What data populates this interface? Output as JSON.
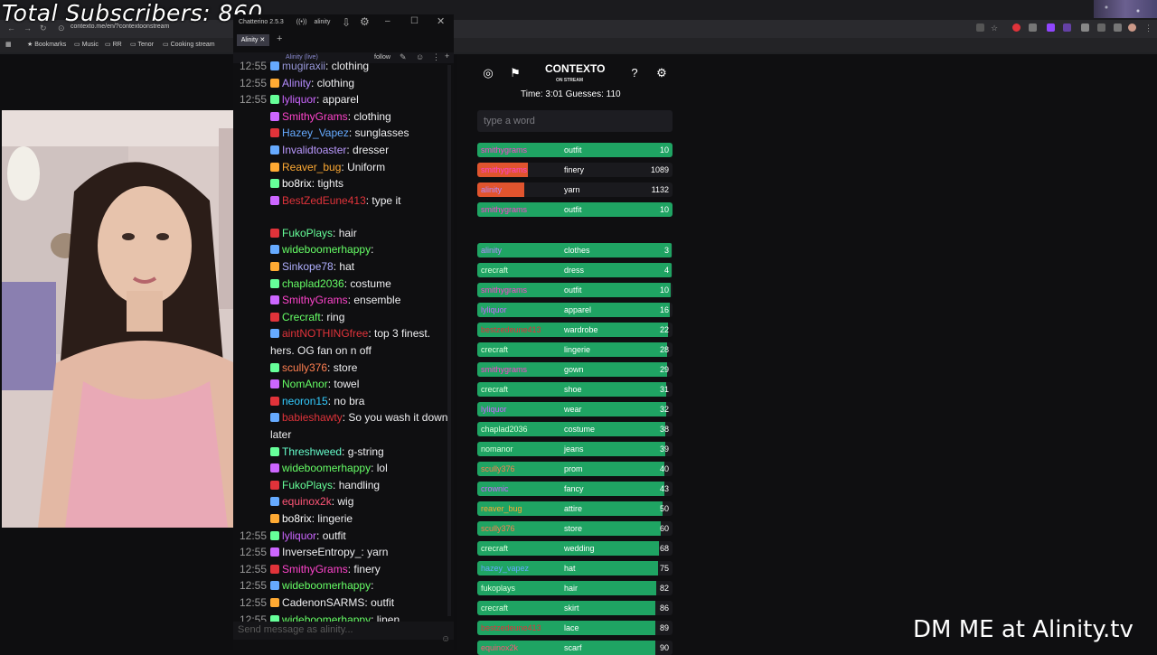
{
  "overlay": {
    "subscribers": "Total Subscribers: 860",
    "dm": "DM ME at Alinity.tv"
  },
  "browser": {
    "url": "contexto.me/en/?contextoonstream",
    "bookmarks": [
      "Bookmarks",
      "Music",
      "RR",
      "Tenor",
      "Cooking stream"
    ]
  },
  "chatterino": {
    "title": "Chatterino 2.5.3",
    "channel_tab_name": "alinity",
    "tab": "Alinity",
    "channel_label": "Alinity (live)",
    "follow": "follow",
    "input_placeholder": "Send message as alinity...",
    "messages": [
      {
        "time": "12:55",
        "user": "mugiraxii",
        "text": "clothing",
        "color": "#9b9bde"
      },
      {
        "time": "12:55",
        "user": "Alinity",
        "text": "clothing",
        "color": "#b58cff"
      },
      {
        "time": "12:55",
        "user": "lyliquor",
        "text": "apparel",
        "color": "#cc66ff"
      },
      {
        "time": "",
        "user": "SmithyGrams",
        "text": "clothing",
        "color": "#ff44cc"
      },
      {
        "time": "",
        "user": "Hazey_Vapez",
        "text": "sunglasses",
        "color": "#66aaff"
      },
      {
        "time": "",
        "user": "Invalidtoaster",
        "text": "dresser",
        "color": "#bb99ff"
      },
      {
        "time": "",
        "user": "Reaver_bug",
        "text": "Uniform",
        "color": "#ffaa33"
      },
      {
        "time": "",
        "user": "bo8rix",
        "text": "tights",
        "color": "#ffffff"
      },
      {
        "time": "",
        "user": "BestZedEune413",
        "text": "type it",
        "color": "#e0333a"
      },
      {
        "time": "",
        "user": "FukoPlays",
        "text": "hair",
        "color": "#66ff99"
      },
      {
        "time": "",
        "user": "wideboomerhappy",
        "text": "",
        "color": "#66ff66"
      },
      {
        "time": "",
        "user": "Sinkope78",
        "text": "hat",
        "color": "#b0b0ff"
      },
      {
        "time": "",
        "user": "chaplad2036",
        "text": "costume",
        "color": "#66ff66"
      },
      {
        "time": "",
        "user": "SmithyGrams",
        "text": "ensemble",
        "color": "#ff44cc"
      },
      {
        "time": "",
        "user": "Crecraft",
        "text": "ring",
        "color": "#66ff66"
      },
      {
        "time": "",
        "user": "aintNOTHINGfree",
        "text": "top 3 finest.",
        "color": "#e0333a"
      },
      {
        "time": "",
        "user": "",
        "text": "hers. OG fan on n off",
        "color": "#efeff1"
      },
      {
        "time": "",
        "user": "scully376",
        "text": "store",
        "color": "#ff7f50"
      },
      {
        "time": "",
        "user": "NomAnor",
        "text": "towel",
        "color": "#66ff66"
      },
      {
        "time": "",
        "user": "neoron15",
        "text": "no bra",
        "color": "#33ccff"
      },
      {
        "time": "",
        "user": "babieshawty",
        "text": "So you wash it down",
        "color": "#e0333a"
      },
      {
        "time": "",
        "user": "",
        "text": "later",
        "color": "#efeff1"
      },
      {
        "time": "",
        "user": "Threshweed",
        "text": "g-string",
        "color": "#66ffcc"
      },
      {
        "time": "",
        "user": "wideboomerhappy",
        "text": "lol",
        "color": "#66ff66"
      },
      {
        "time": "",
        "user": "FukoPlays",
        "text": "handling",
        "color": "#66ff99"
      },
      {
        "time": "",
        "user": "equinox2k",
        "text": "wig",
        "color": "#ff5577"
      },
      {
        "time": "",
        "user": "bo8rix",
        "text": "lingerie",
        "color": "#ffffff"
      },
      {
        "time": "12:55",
        "user": "lyliquor",
        "text": "outfit",
        "color": "#cc66ff"
      },
      {
        "time": "12:55",
        "user": "InverseEntropy_",
        "text": "yarn",
        "color": "#efeff1"
      },
      {
        "time": "12:55",
        "user": "SmithyGrams",
        "text": "finery",
        "color": "#ff44cc"
      },
      {
        "time": "12:55",
        "user": "wideboomerhappy",
        "text": "",
        "color": "#66ff66"
      },
      {
        "time": "12:55",
        "user": "CadenonSARMS",
        "text": "outfit",
        "color": "#efeff1"
      },
      {
        "time": "12:55",
        "user": "wideboomerhappy",
        "text": "linen",
        "color": "#66ff66"
      }
    ]
  },
  "contexto": {
    "title": "CONTEXTO",
    "subtitle": "ON STREAM",
    "stats": "Time: 3:01    Guesses: 110",
    "input_placeholder": "type a word",
    "recent": [
      {
        "name": "smithygrams",
        "word": "outfit",
        "rank": "10",
        "color": "#1fa463",
        "frac": 1.0,
        "name_color": "#ff44cc"
      },
      {
        "name": "smithygrams",
        "word": "finery",
        "rank": "1089",
        "color": "#e0542e",
        "frac": 0.26,
        "name_color": "#ff44cc"
      },
      {
        "name": "alinity",
        "word": "yarn",
        "rank": "1132",
        "color": "#e0542e",
        "frac": 0.24,
        "name_color": "#b58cff"
      },
      {
        "name": "smithygrams",
        "word": "outfit",
        "rank": "10",
        "color": "#1fa463",
        "frac": 1.0,
        "name_color": "#ff44cc"
      }
    ],
    "list": [
      {
        "name": "alinity",
        "word": "clothes",
        "rank": "3",
        "name_color": "#b58cff"
      },
      {
        "name": "crecraft",
        "word": "dress",
        "rank": "4",
        "name_color": "#dfffdf"
      },
      {
        "name": "smithygrams",
        "word": "outfit",
        "rank": "10",
        "name_color": "#ff44cc"
      },
      {
        "name": "lyliquor",
        "word": "apparel",
        "rank": "16",
        "name_color": "#cc66ff"
      },
      {
        "name": "bestzedeune413",
        "word": "wardrobe",
        "rank": "22",
        "name_color": "#e0333a"
      },
      {
        "name": "crecraft",
        "word": "lingerie",
        "rank": "28",
        "name_color": "#dfffdf"
      },
      {
        "name": "smithygrams",
        "word": "gown",
        "rank": "29",
        "name_color": "#ff44cc"
      },
      {
        "name": "crecraft",
        "word": "shoe",
        "rank": "31",
        "name_color": "#dfffdf"
      },
      {
        "name": "lyliquor",
        "word": "wear",
        "rank": "32",
        "name_color": "#cc66ff"
      },
      {
        "name": "chaplad2036",
        "word": "costume",
        "rank": "38",
        "name_color": "#dfffdf"
      },
      {
        "name": "nomanor",
        "word": "jeans",
        "rank": "39",
        "name_color": "#dfffdf"
      },
      {
        "name": "scully376",
        "word": "prom",
        "rank": "40",
        "name_color": "#ff7f50"
      },
      {
        "name": "crownic",
        "word": "fancy",
        "rank": "43",
        "name_color": "#cc66ff"
      },
      {
        "name": "reaver_bug",
        "word": "attire",
        "rank": "50",
        "name_color": "#ffaa33"
      },
      {
        "name": "scully376",
        "word": "store",
        "rank": "60",
        "name_color": "#ff7f50"
      },
      {
        "name": "crecraft",
        "word": "wedding",
        "rank": "68",
        "name_color": "#dfffdf"
      },
      {
        "name": "hazey_vapez",
        "word": "hat",
        "rank": "75",
        "name_color": "#66aaff"
      },
      {
        "name": "fukoplays",
        "word": "hair",
        "rank": "82",
        "name_color": "#dfffdf"
      },
      {
        "name": "crecraft",
        "word": "skirt",
        "rank": "86",
        "name_color": "#dfffdf"
      },
      {
        "name": "bestzedeune413",
        "word": "lace",
        "rank": "89",
        "name_color": "#e0333a"
      },
      {
        "name": "equinox2k",
        "word": "scarf",
        "rank": "90",
        "name_color": "#ff5577"
      }
    ],
    "bar_color": "#1fa463"
  }
}
